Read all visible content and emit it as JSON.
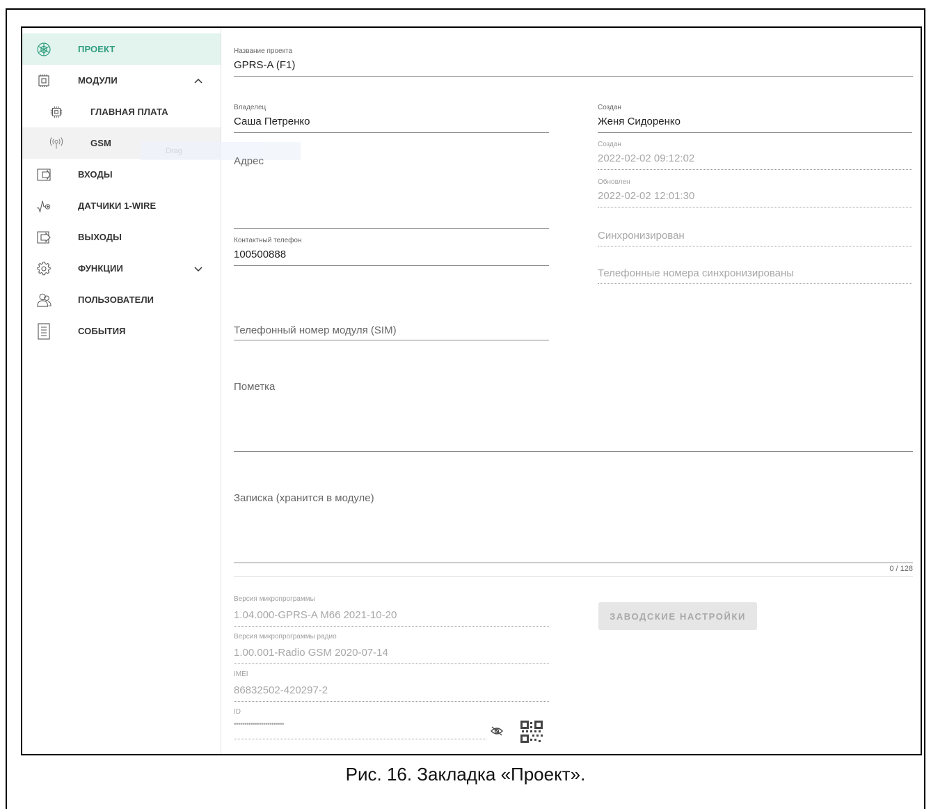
{
  "sidebar": {
    "items": [
      {
        "label": "ПРОЕКТ",
        "icon": "project-icon",
        "state": "active"
      },
      {
        "label": "МОДУЛИ",
        "icon": "modules-icon",
        "expander": "chevron-up-icon"
      },
      {
        "label": "ГЛАВНАЯ ПЛАТА",
        "icon": "mainboard-icon",
        "sub": true
      },
      {
        "label": "GSM",
        "icon": "gsm-antenna-icon",
        "sub": true,
        "state": "hover"
      },
      {
        "label": "ВХОДЫ",
        "icon": "inputs-icon"
      },
      {
        "label": "ДАТЧИКИ 1-WIRE",
        "icon": "sensor-icon"
      },
      {
        "label": "ВЫХОДЫ",
        "icon": "outputs-icon"
      },
      {
        "label": "ФУНКЦИИ",
        "icon": "gear-icon",
        "expander": "chevron-down-icon"
      },
      {
        "label": "ПОЛЬЗОВАТЕЛИ",
        "icon": "users-icon"
      },
      {
        "label": "СОБЫТИЯ",
        "icon": "events-icon"
      }
    ],
    "drag_ghost_label": "Drag"
  },
  "form": {
    "project_name": {
      "label": "Название проекта",
      "value": "GPRS-A (F1)"
    },
    "owner": {
      "label": "Владелец",
      "value": "Саша Петренко"
    },
    "created_by": {
      "label": "Создан",
      "value": "Женя Сидоренко"
    },
    "address": {
      "placeholder": "Адрес"
    },
    "created_at": {
      "label": "Создан",
      "value": "2022-02-02 09:12:02"
    },
    "updated_at": {
      "label": "Обновлен",
      "value": "2022-02-02 12:01:30"
    },
    "contact_phone": {
      "label": "Контактный телефон",
      "value": "100500888"
    },
    "synchronized": {
      "placeholder": "Синхронизирован"
    },
    "phones_synchronized": {
      "placeholder": "Телефонные номера синхронизированы"
    },
    "sim_number": {
      "placeholder": "Телефонный номер модуля (SIM)"
    },
    "note": {
      "placeholder": "Пометка"
    },
    "memo": {
      "placeholder": "Записка (хранится в модуле)",
      "counter": "0 / 128"
    },
    "firmware": {
      "label": "Версия микропрограммы",
      "value": "1.04.000-GPRS-A M66 2021-10-20"
    },
    "radio_firmware": {
      "label": "Версия микропрограммы радио",
      "value": "1.00.001-Radio GSM 2020-07-14"
    },
    "imei": {
      "label": "IMEI",
      "value": "86832502-420297-2"
    },
    "id": {
      "label": "ID",
      "value": "••••••••••••••••••••••••"
    },
    "factory_button": "ЗАВОДСКИЕ НАСТРОЙКИ"
  },
  "caption": "Рис. 16. Закладка «Проект».",
  "colors": {
    "accent": "#2e9e7e",
    "active_bg": "#e3f3ee"
  }
}
